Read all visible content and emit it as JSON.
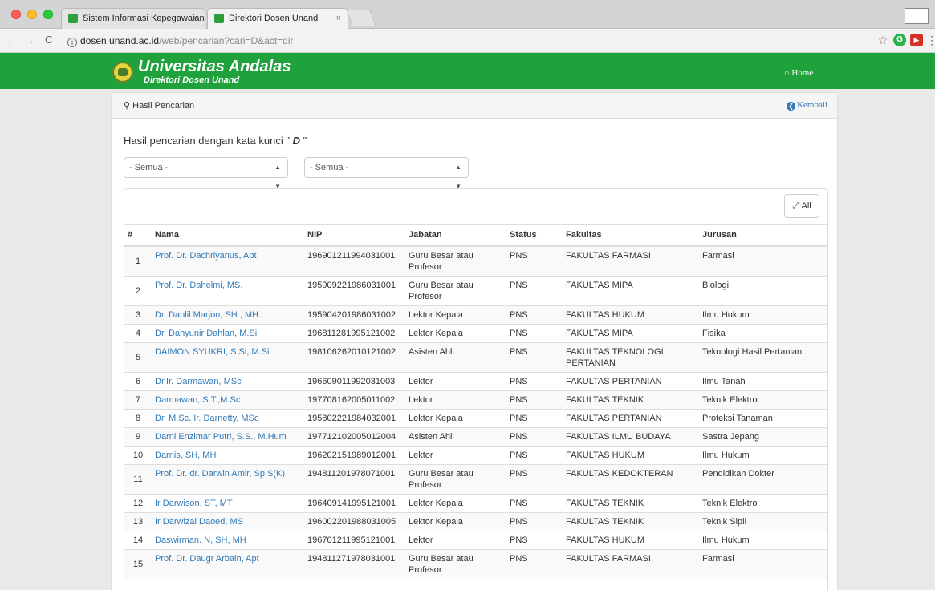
{
  "browser": {
    "tabs": [
      {
        "title": "Sistem Informasi Kepegawaian",
        "close": "×"
      },
      {
        "title": "Direktori Dosen Unand",
        "close": "×"
      }
    ],
    "nav": {
      "back": "←",
      "forward": "→",
      "reload": "C"
    },
    "url_host": "dosen.unand.ac.id",
    "url_path": "/web/pencarian?cari=D&act=dir",
    "ext_g": "G",
    "ext_play": "▶",
    "menu": "⋮",
    "star": "☆"
  },
  "header": {
    "title": "Universitas Andalas",
    "subtitle": "Direktori Dosen Unand",
    "home": "Home",
    "brand_color": "#1fa13c"
  },
  "panel": {
    "title": "Hasil Pencarian",
    "back": "Kembali",
    "search_prefix": "Hasil pencarian dengan kata kunci \" ",
    "search_keyword": "D",
    "search_suffix": " \"",
    "filter1": "- Semua -",
    "filter2": "- Semua -",
    "all_button": "All"
  },
  "table": {
    "headers": [
      "#",
      "Nama",
      "NIP",
      "Jabatan",
      "Status",
      "Fakultas",
      "Jurusan"
    ],
    "rows": [
      [
        "1",
        "Prof. Dr. Dachriyanus, Apt",
        "196901211994031001",
        "Guru Besar atau Profesor",
        "PNS",
        "FAKULTAS FARMASI",
        "Farmasi"
      ],
      [
        "2",
        "Prof. Dr. Dahelmi, MS.",
        "195909221986031001",
        "Guru Besar atau Profesor",
        "PNS",
        "FAKULTAS MIPA",
        "Biologi"
      ],
      [
        "3",
        "Dr. Dahlil Marjon, SH., MH.",
        "195904201986031002",
        "Lektor Kepala",
        "PNS",
        "FAKULTAS HUKUM",
        "Ilmu Hukum"
      ],
      [
        "4",
        "Dr. Dahyunir Dahlan, M.Si",
        "196811281995121002",
        "Lektor Kepala",
        "PNS",
        "FAKULTAS MIPA",
        "Fisika"
      ],
      [
        "5",
        "DAIMON SYUKRI, S.Si, M.Si",
        "198106262010121002",
        "Asisten Ahli",
        "PNS",
        "FAKULTAS TEKNOLOGI PERTANIAN",
        "Teknologi Hasil Pertanian"
      ],
      [
        "6",
        "Dr.Ir. Darmawan, MSc",
        "196609011992031003",
        "Lektor",
        "PNS",
        "FAKULTAS PERTANIAN",
        "Ilmu Tanah"
      ],
      [
        "7",
        "Darmawan, S.T.,M.Sc",
        "197708162005011002",
        "Lektor",
        "PNS",
        "FAKULTAS TEKNIK",
        "Teknik Elektro"
      ],
      [
        "8",
        "Dr. M.Sc. Ir. Darnetty, MSc",
        "195802221984032001",
        "Lektor Kepala",
        "PNS",
        "FAKULTAS PERTANIAN",
        "Proteksi Tanaman"
      ],
      [
        "9",
        "Darni Enzimar Putri, S.S., M.Hum",
        "197712102005012004",
        "Asisten Ahli",
        "PNS",
        "FAKULTAS ILMU BUDAYA",
        "Sastra Jepang"
      ],
      [
        "10",
        "Darnis, SH, MH",
        "196202151989012001",
        "Lektor",
        "PNS",
        "FAKULTAS HUKUM",
        "Ilmu Hukum"
      ],
      [
        "11",
        "Prof. Dr. dr. Darwin Amir, Sp.S(K)",
        "194811201978071001",
        "Guru Besar atau Profesor",
        "PNS",
        "FAKULTAS KEDOKTERAN",
        "Pendidikan Dokter"
      ],
      [
        "12",
        "Ir Darwison, ST, MT",
        "196409141995121001",
        "Lektor Kepala",
        "PNS",
        "FAKULTAS TEKNIK",
        "Teknik Elektro"
      ],
      [
        "13",
        "Ir Darwizal Daoed, MS",
        "196002201988031005",
        "Lektor Kepala",
        "PNS",
        "FAKULTAS TEKNIK",
        "Teknik Sipil"
      ],
      [
        "14",
        "Daswirman. N, SH, MH",
        "196701211995121001",
        "Lektor",
        "PNS",
        "FAKULTAS HUKUM",
        "Ilmu Hukum"
      ],
      [
        "15",
        "Prof. Dr. Daugr Arbain, Apt",
        "194811271978031001",
        "Guru Besar atau Profesor",
        "PNS",
        "FAKULTAS FARMASI",
        "Farmasi"
      ]
    ]
  }
}
